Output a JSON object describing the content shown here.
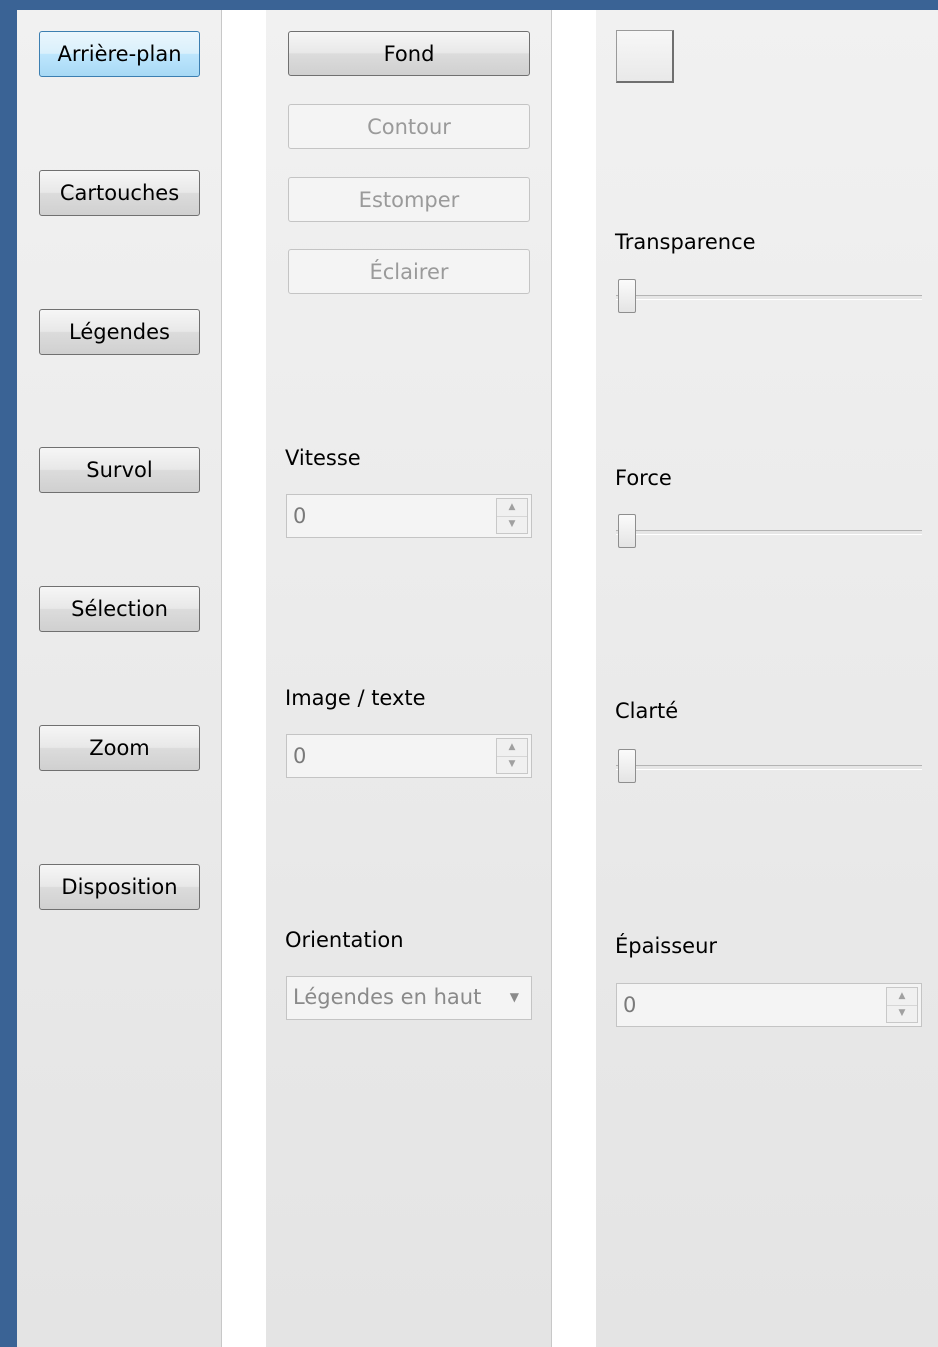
{
  "nav": {
    "items": [
      {
        "label": "Arrière-plan",
        "active": true
      },
      {
        "label": "Cartouches"
      },
      {
        "label": "Légendes"
      },
      {
        "label": "Survol"
      },
      {
        "label": "Sélection"
      },
      {
        "label": "Zoom"
      },
      {
        "label": "Disposition"
      }
    ]
  },
  "middle": {
    "buttons": [
      {
        "label": "Fond",
        "enabled": true
      },
      {
        "label": "Contour",
        "enabled": false
      },
      {
        "label": "Estomper",
        "enabled": false
      },
      {
        "label": "Éclairer",
        "enabled": false
      }
    ],
    "vitesse": {
      "label": "Vitesse",
      "value": "0"
    },
    "image_texte": {
      "label": "Image / texte",
      "value": "0"
    },
    "orientation": {
      "label": "Orientation",
      "selected": "Légendes en haut"
    }
  },
  "right": {
    "transparence": {
      "label": "Transparence",
      "value": 0
    },
    "force": {
      "label": "Force",
      "value": 0
    },
    "clarte": {
      "label": "Clarté",
      "value": 0
    },
    "epaisseur": {
      "label": "Épaisseur",
      "value": "0"
    }
  },
  "colors": {
    "window_background": "#3a6395",
    "active_button": "#bee6fd"
  },
  "icons": {
    "spin_up": "triangle-up",
    "spin_down": "triangle-down",
    "combo_caret": "triangle-down"
  }
}
